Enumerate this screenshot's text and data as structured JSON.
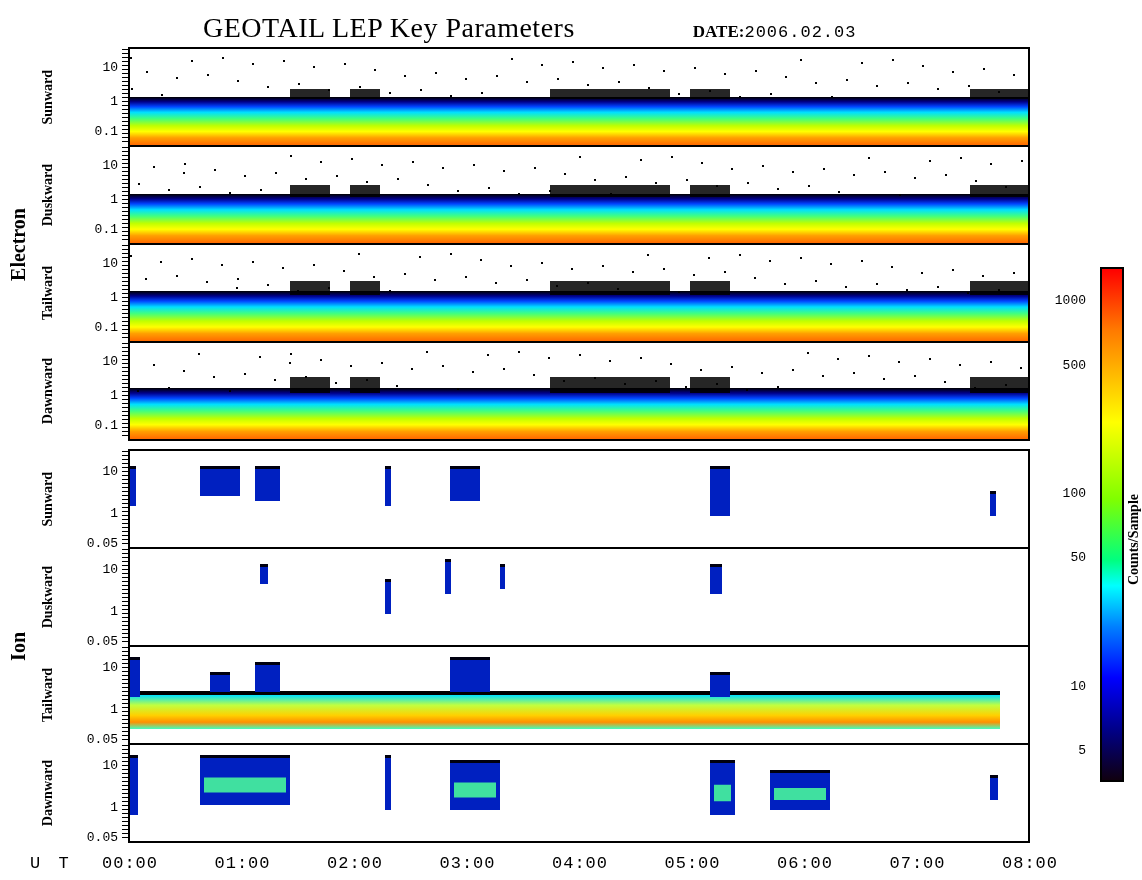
{
  "title": "GEOTAIL LEP Key Parameters",
  "date_label": "DATE:",
  "date": "2006.02.03",
  "groups": [
    {
      "label": "Electron",
      "kind": "electron",
      "panels": [
        {
          "label": "Sunward",
          "y_ticks": [
            "10",
            "1",
            "0.1"
          ]
        },
        {
          "label": "Duskward",
          "y_ticks": [
            "10",
            "1",
            "0.1"
          ]
        },
        {
          "label": "Tailward",
          "y_ticks": [
            "10",
            "1",
            "0.1"
          ]
        },
        {
          "label": "Dawnward",
          "y_ticks": [
            "10",
            "1",
            "0.1"
          ]
        }
      ]
    },
    {
      "label": "Ion",
      "kind": "ion",
      "panels": [
        {
          "label": "Sunward",
          "y_ticks": [
            "10",
            "1",
            "0.05"
          ]
        },
        {
          "label": "Duskward",
          "y_ticks": [
            "10",
            "1",
            "0.05"
          ]
        },
        {
          "label": "Tailward",
          "y_ticks": [
            "10",
            "1",
            "0.05"
          ]
        },
        {
          "label": "Dawnward",
          "y_ticks": [
            "10",
            "1",
            "0.05"
          ]
        }
      ]
    }
  ],
  "x_axis": {
    "label": "U T",
    "ticks": [
      "00:00",
      "01:00",
      "02:00",
      "03:00",
      "04:00",
      "05:00",
      "06:00",
      "07:00",
      "08:00"
    ]
  },
  "colorbar": {
    "label": "Counts/Sample",
    "ticks": [
      "1000",
      "500",
      "100",
      "50",
      "10",
      "5"
    ]
  }
}
